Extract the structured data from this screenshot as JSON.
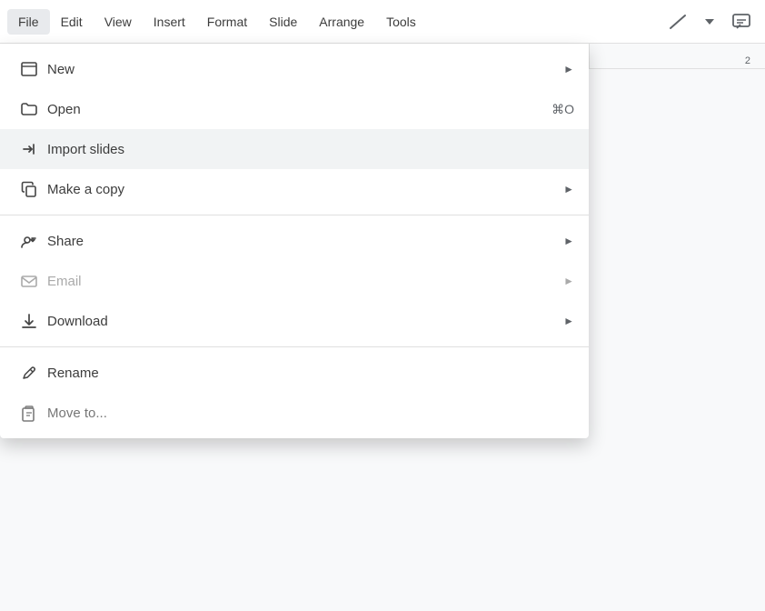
{
  "menubar": {
    "items": [
      {
        "id": "file",
        "label": "File",
        "active": true
      },
      {
        "id": "edit",
        "label": "Edit"
      },
      {
        "id": "view",
        "label": "View"
      },
      {
        "id": "insert",
        "label": "Insert"
      },
      {
        "id": "format",
        "label": "Format"
      },
      {
        "id": "slide",
        "label": "Slide"
      },
      {
        "id": "arrange",
        "label": "Arrange"
      },
      {
        "id": "tools",
        "label": "Tools"
      }
    ]
  },
  "dropdown": {
    "items": [
      {
        "id": "new",
        "label": "New",
        "icon": "window-icon",
        "shortcut": "",
        "hasArrow": true,
        "disabled": false,
        "dividerAfter": false
      },
      {
        "id": "open",
        "label": "Open",
        "icon": "folder-icon",
        "shortcut": "⌘O",
        "hasArrow": false,
        "disabled": false,
        "dividerAfter": false
      },
      {
        "id": "import-slides",
        "label": "Import slides",
        "icon": "import-icon",
        "shortcut": "",
        "hasArrow": false,
        "disabled": false,
        "dividerAfter": false,
        "highlighted": true
      },
      {
        "id": "make-a-copy",
        "label": "Make a copy",
        "icon": "copy-icon",
        "shortcut": "",
        "hasArrow": true,
        "disabled": false,
        "dividerAfter": true
      },
      {
        "id": "share",
        "label": "Share",
        "icon": "share-icon",
        "shortcut": "",
        "hasArrow": true,
        "disabled": false,
        "dividerAfter": false
      },
      {
        "id": "email",
        "label": "Email",
        "icon": "email-icon",
        "shortcut": "",
        "hasArrow": true,
        "disabled": true,
        "dividerAfter": false
      },
      {
        "id": "download",
        "label": "Download",
        "icon": "download-icon",
        "shortcut": "",
        "hasArrow": true,
        "disabled": false,
        "dividerAfter": true
      },
      {
        "id": "rename",
        "label": "Rename",
        "icon": "rename-icon",
        "shortcut": "",
        "hasArrow": false,
        "disabled": false,
        "dividerAfter": false
      },
      {
        "id": "move-to",
        "label": "Move to...",
        "icon": "move-icon",
        "shortcut": "",
        "hasArrow": false,
        "disabled": false,
        "dividerAfter": false
      }
    ]
  },
  "icons": {
    "window": "⬜",
    "folder": "📁",
    "import": "→",
    "copy": "⧉",
    "share": "👤+",
    "email": "✉",
    "download": "⬇",
    "rename": "✏",
    "move": "📄"
  },
  "ruler": {
    "number": "2"
  }
}
